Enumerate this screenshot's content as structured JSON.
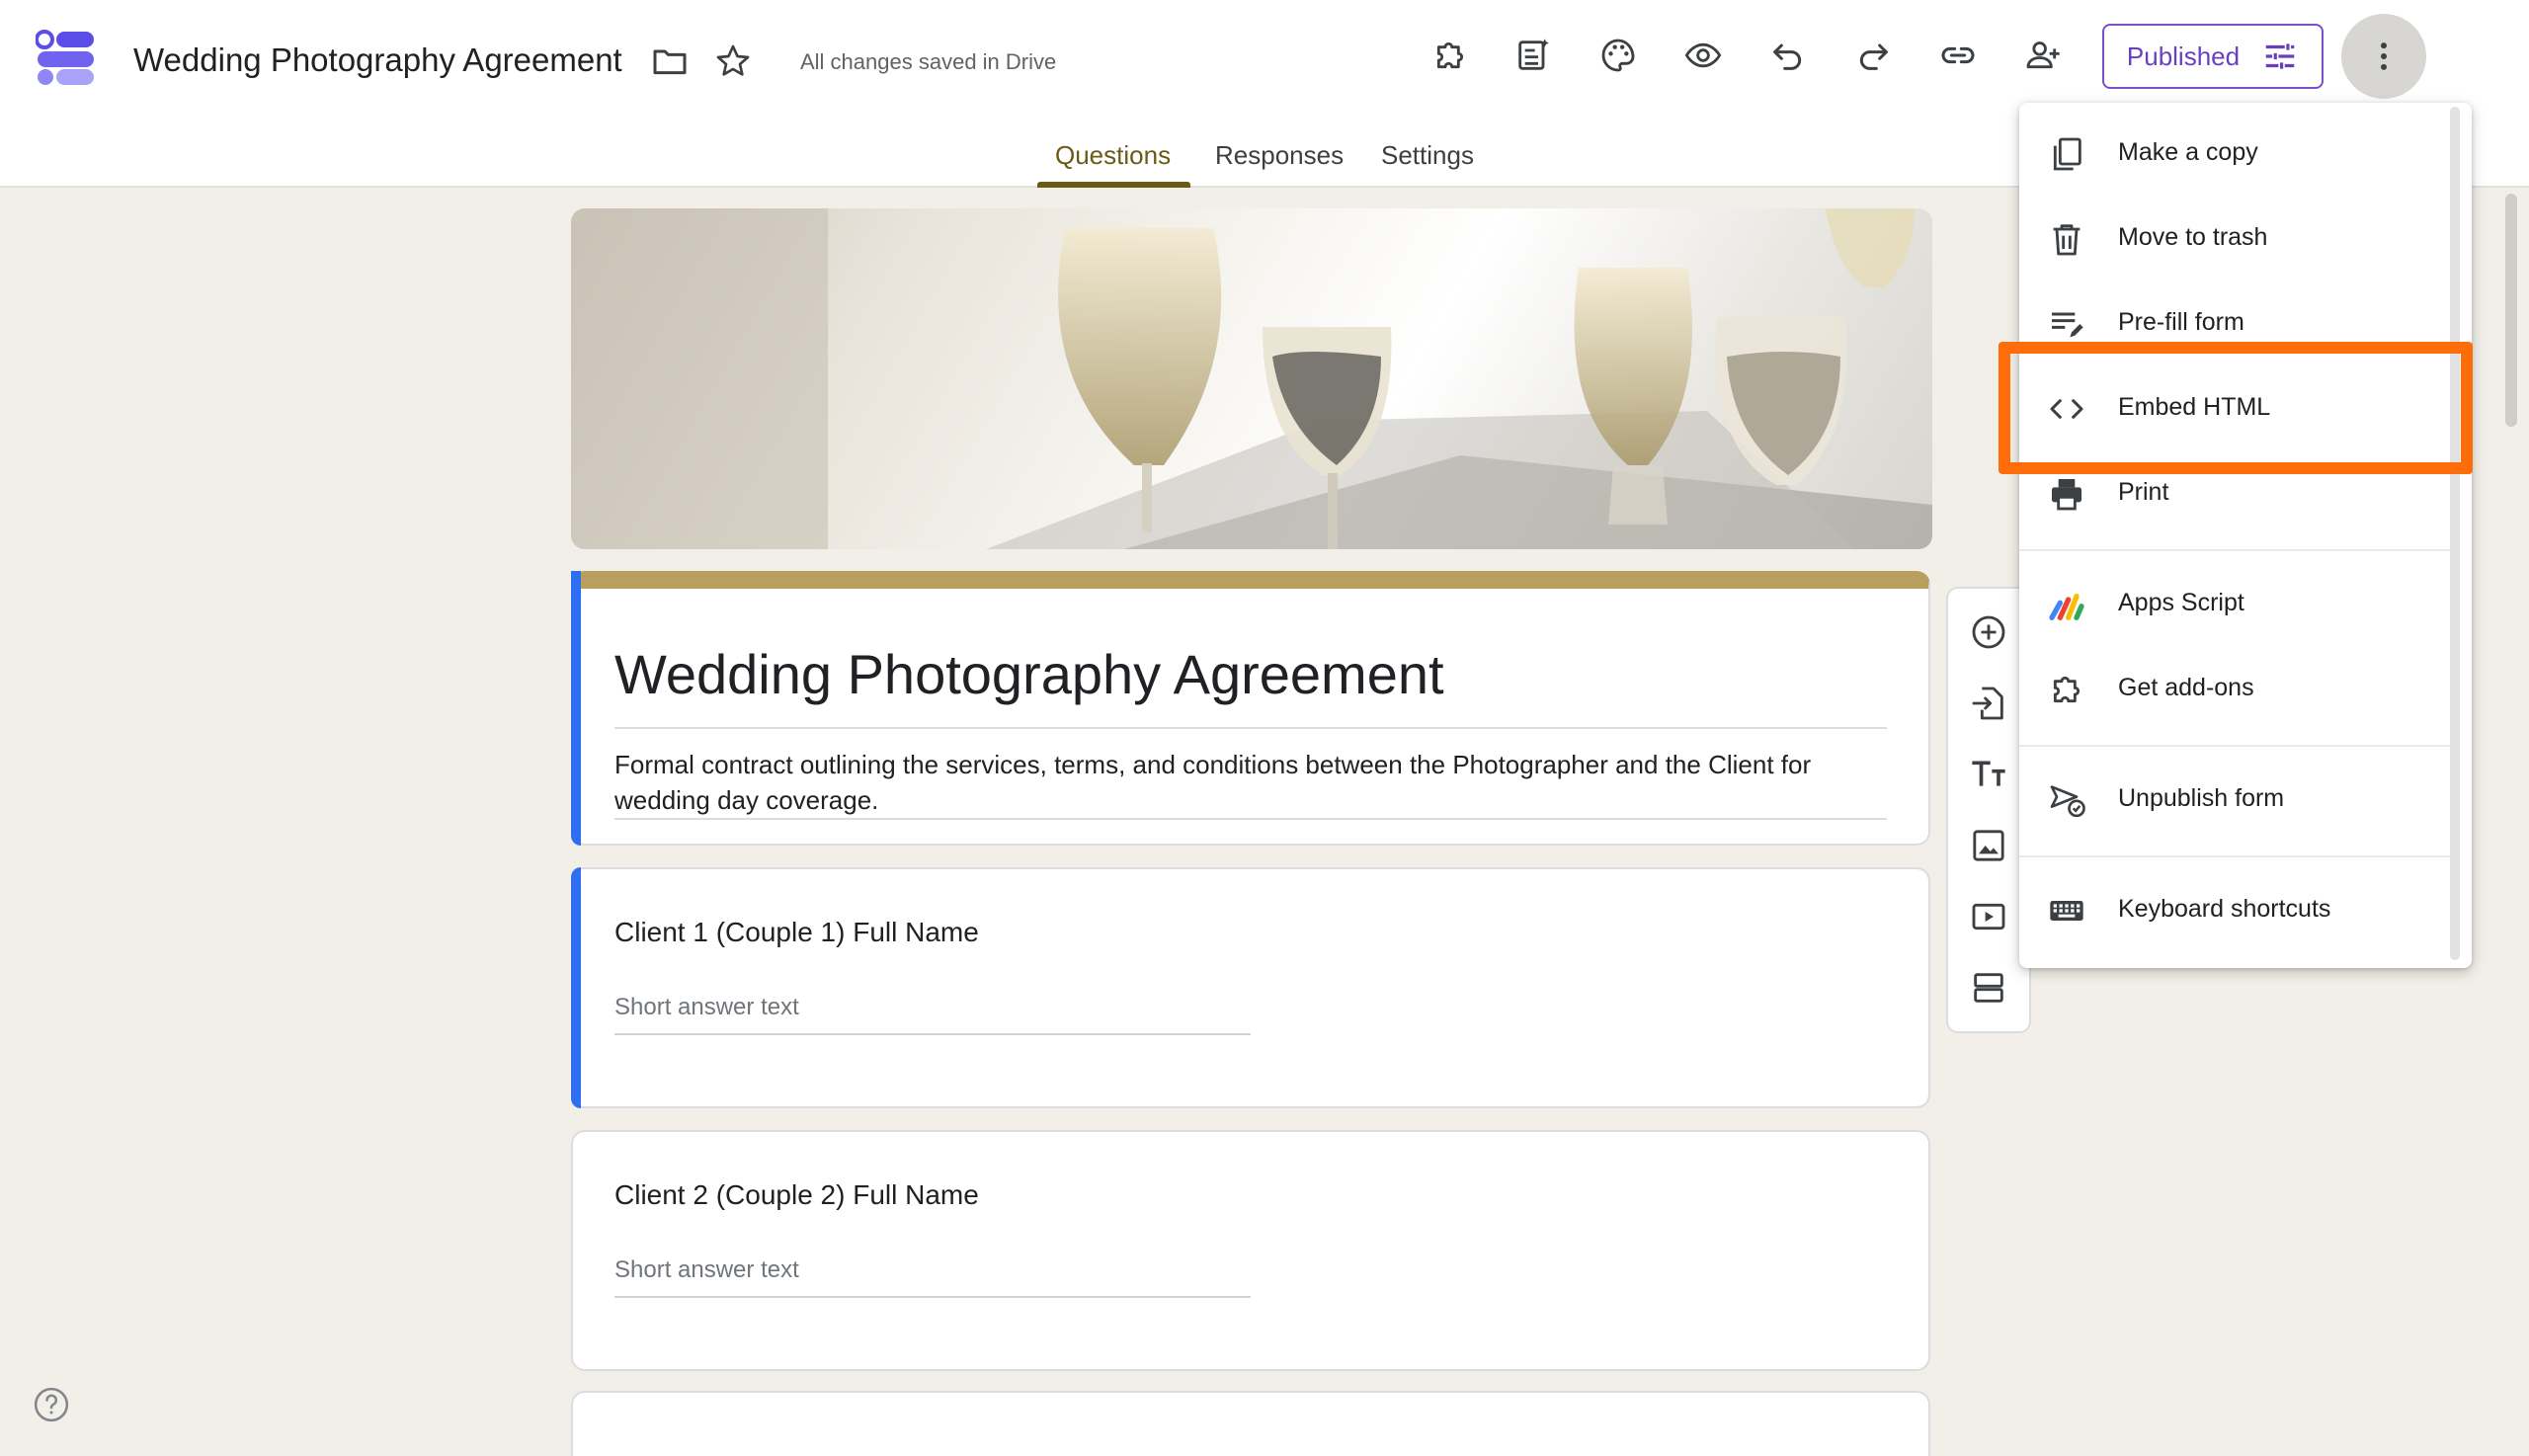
{
  "header": {
    "doc_title": "Wedding Photography Agreement",
    "save_status": "All changes saved in Drive",
    "publish_label": "Published",
    "icons": [
      "folder-icon",
      "star-icon",
      "addons-icon",
      "ai-form-icon",
      "palette-icon",
      "preview-icon",
      "undo-icon",
      "redo-icon",
      "link-icon",
      "add-collaborator-icon",
      "more-vert-icon"
    ]
  },
  "tabs": [
    {
      "label": "Questions",
      "active": true
    },
    {
      "label": "Responses",
      "active": false
    },
    {
      "label": "Settings",
      "active": false
    }
  ],
  "form": {
    "title": "Wedding Photography Agreement",
    "description": "Formal contract outlining the services, terms, and conditions between the Photographer and the Client for wedding day coverage.",
    "theme_color": "#b89f5e",
    "questions": [
      {
        "title": "Client 1 (Couple 1) Full Name",
        "answer_placeholder": "Short answer text"
      },
      {
        "title": "Client 2 (Couple 2) Full Name",
        "answer_placeholder": "Short answer text"
      }
    ]
  },
  "side_toolbar": [
    "add-question-icon",
    "import-questions-icon",
    "add-title-icon",
    "add-image-icon",
    "add-video-icon",
    "add-section-icon"
  ],
  "menu": {
    "items": [
      {
        "label": "Make a copy",
        "icon": "copy-icon"
      },
      {
        "label": "Move to trash",
        "icon": "trash-icon"
      },
      {
        "label": "Pre-fill form",
        "icon": "prefill-icon"
      },
      {
        "label": "Embed HTML",
        "icon": "embed-code-icon",
        "highlighted": true
      },
      {
        "label": "Print",
        "icon": "print-icon"
      },
      {
        "label": "Apps Script",
        "icon": "apps-script-icon"
      },
      {
        "label": "Get add-ons",
        "icon": "addons-icon"
      },
      {
        "label": "Unpublish form",
        "icon": "unpublish-icon"
      },
      {
        "label": "Keyboard shortcuts",
        "icon": "keyboard-icon"
      }
    ]
  },
  "colors": {
    "accent_blue": "#2d6ff0",
    "highlight_orange": "#ff6d0a",
    "publish_purple": "#6a3fbf",
    "tab_active": "#6b5a17"
  }
}
